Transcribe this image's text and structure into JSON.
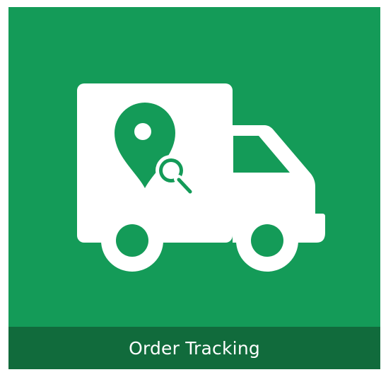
{
  "tile": {
    "title": "Order Tracking",
    "icon": "delivery-truck-location-search-icon"
  },
  "colors": {
    "tile_bg": "#149b58",
    "label_bg": "#116b3c",
    "icon_fg": "#ffffff",
    "icon_accent": "#149b58"
  }
}
